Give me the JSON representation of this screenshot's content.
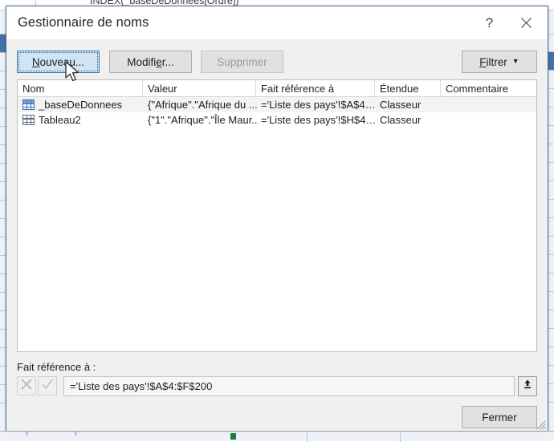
{
  "background": {
    "formula_text": "INDEX(_baseDeDonnees[Ordre])"
  },
  "dialog": {
    "title": "Gestionnaire de noms",
    "help_icon": "question-mark-icon",
    "close_icon": "close-icon"
  },
  "toolbar": {
    "new_label": "Nouveau...",
    "new_accel": "N",
    "edit_label": "Modifier...",
    "edit_accel": "e",
    "delete_label": "Supprimer",
    "filter_label": "Filtrer",
    "filter_accel": "F",
    "filter_caret": "▼"
  },
  "list": {
    "columns": [
      {
        "label": "Nom"
      },
      {
        "label": "Valeur"
      },
      {
        "label": "Fait référence à"
      },
      {
        "label": "Étendue"
      },
      {
        "label": "Commentaire"
      }
    ],
    "rows": [
      {
        "icon": "table-icon-blue",
        "name": "_baseDeDonnees",
        "value": "{\"Afrique\".\"Afrique du ...",
        "refers_to": "='Liste des pays'!$A$4…",
        "scope": "Classeur",
        "comment": "",
        "selected": true
      },
      {
        "icon": "table-icon-plain",
        "name": "Tableau2",
        "value": "{\"1\".\"Afrique\".\"Île Maur...",
        "refers_to": "='Liste des pays'!$H$4…",
        "scope": "Classeur",
        "comment": "",
        "selected": false
      }
    ]
  },
  "reference": {
    "label": "Fait référence à :",
    "cancel_icon": "cancel-x-icon",
    "accept_icon": "accept-check-icon",
    "value": "='Liste des pays'!$A$4:$F$200",
    "placeholder": "",
    "collapse_icon": "collapse-dialog-icon"
  },
  "footer": {
    "close_label": "Fermer"
  },
  "colors": {
    "dialog_border": "#4a6f9a",
    "dialog_bg": "#f0f0f0",
    "focus_blue": "#cfe5f5",
    "selection_row": "#f3f3f3",
    "excel_header": "#eef2f7"
  }
}
